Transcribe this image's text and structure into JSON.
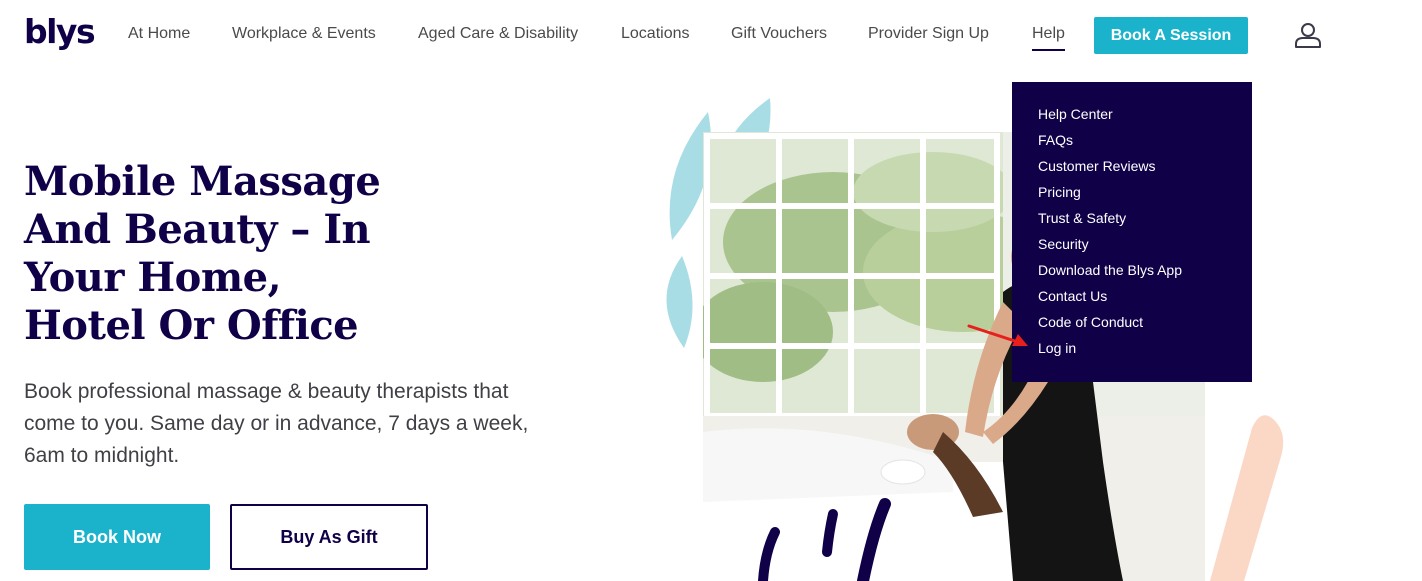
{
  "header": {
    "logo_text": "blys",
    "nav": [
      {
        "label": "At Home"
      },
      {
        "label": "Workplace & Events"
      },
      {
        "label": "Aged Care & Disability"
      },
      {
        "label": "Locations"
      },
      {
        "label": "Gift Vouchers"
      },
      {
        "label": "Provider Sign Up"
      },
      {
        "label": "Help"
      }
    ],
    "cta_label": "Book A Session",
    "user_icon": "user-icon"
  },
  "help_menu": {
    "items": [
      {
        "label": "Help Center"
      },
      {
        "label": "FAQs"
      },
      {
        "label": "Customer Reviews"
      },
      {
        "label": "Pricing"
      },
      {
        "label": "Trust & Safety"
      },
      {
        "label": "Security"
      },
      {
        "label": "Download the Blys App"
      },
      {
        "label": "Contact Us"
      },
      {
        "label": "Code of Conduct"
      },
      {
        "label": "Log in"
      }
    ]
  },
  "hero": {
    "title_lines": [
      "Mobile Massage",
      "And Beauty – In",
      "Your Home,",
      "Hotel Or Office"
    ],
    "subtitle": "Book professional massage & beauty therapists that come to you. Same day or in advance, 7 days a week, 6am to midnight.",
    "primary_button": "Book Now",
    "secondary_button": "Buy As Gift"
  },
  "colors": {
    "brand_navy": "#100048",
    "accent_teal": "#1bb3cc",
    "leaf_blue": "#a9dde6",
    "peach": "#fbd7c6",
    "annotation_red": "#e8201c"
  }
}
